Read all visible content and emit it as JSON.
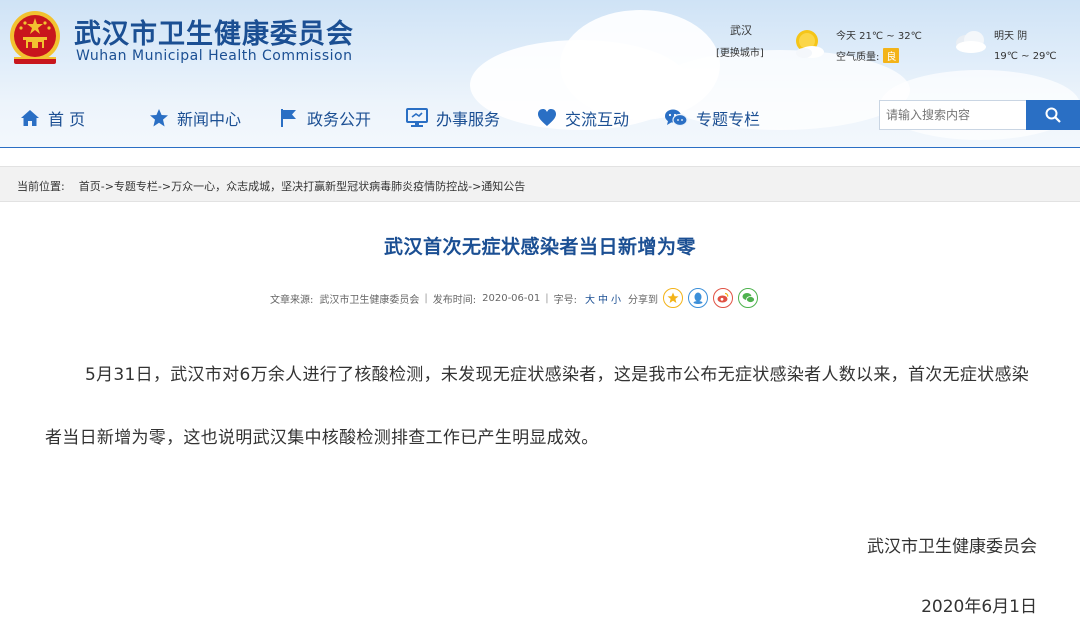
{
  "site": {
    "title_cn": "武汉市卫生健康委员会",
    "title_en": "Wuhan Municipal Health Commission"
  },
  "weather": {
    "city": "武汉",
    "switch_label": "[更换城市]",
    "today": "今天  21℃ ~ 32℃",
    "air_quality_label": "空气质量:",
    "air_quality_value": "良",
    "tomorrow_line1": "明天  阴",
    "tomorrow_line2": "19℃ ~ 29℃",
    "icons": [
      "sun-icon",
      "cloud-icon"
    ]
  },
  "nav": {
    "items": [
      {
        "label": "首  页",
        "icon": "home-icon"
      },
      {
        "label": "新闻中心",
        "icon": "star-icon"
      },
      {
        "label": "政务公开",
        "icon": "flag-icon"
      },
      {
        "label": "办事服务",
        "icon": "monitor-icon"
      },
      {
        "label": "交流互动",
        "icon": "heart-icon"
      },
      {
        "label": "专题专栏",
        "icon": "chat-icon"
      }
    ]
  },
  "search": {
    "placeholder": "请输入搜索内容",
    "button_icon": "search-icon"
  },
  "breadcrumb": {
    "label": "当前位置:",
    "items": [
      "首页",
      "专题专栏",
      "万众一心，众志成城，坚决打赢新型冠状病毒肺炎疫情防控战",
      "通知公告"
    ],
    "separator": "->"
  },
  "article": {
    "title": "武汉首次无症状感染者当日新增为零",
    "source_label": "文章来源:",
    "source": "武汉市卫生健康委员会",
    "date_label": "发布时间:",
    "date": "2020-06-01",
    "font_label": "字号:",
    "font_large": "大",
    "font_medium": "中",
    "font_small": "小",
    "share_label": "分享到",
    "share_icons": [
      "qzone-icon",
      "qq-icon",
      "weibo-icon",
      "wechat-icon"
    ],
    "body": "5月31日，武汉市对6万余人进行了核酸检测，未发现无症状感染者，这是我市公布无症状感染者人数以来，首次无症状感染者当日新增为零，这也说明武汉集中核酸检测排查工作已产生明显成效。",
    "signature_org": "武汉市卫生健康委员会",
    "signature_date": "2020年6月1日"
  },
  "colors": {
    "brand_blue": "#1b4f93",
    "accent_blue": "#2a6fc4",
    "air_quality_badge": "#f3b318",
    "emblem_red": "#c8161d",
    "emblem_gold": "#f2c230"
  }
}
